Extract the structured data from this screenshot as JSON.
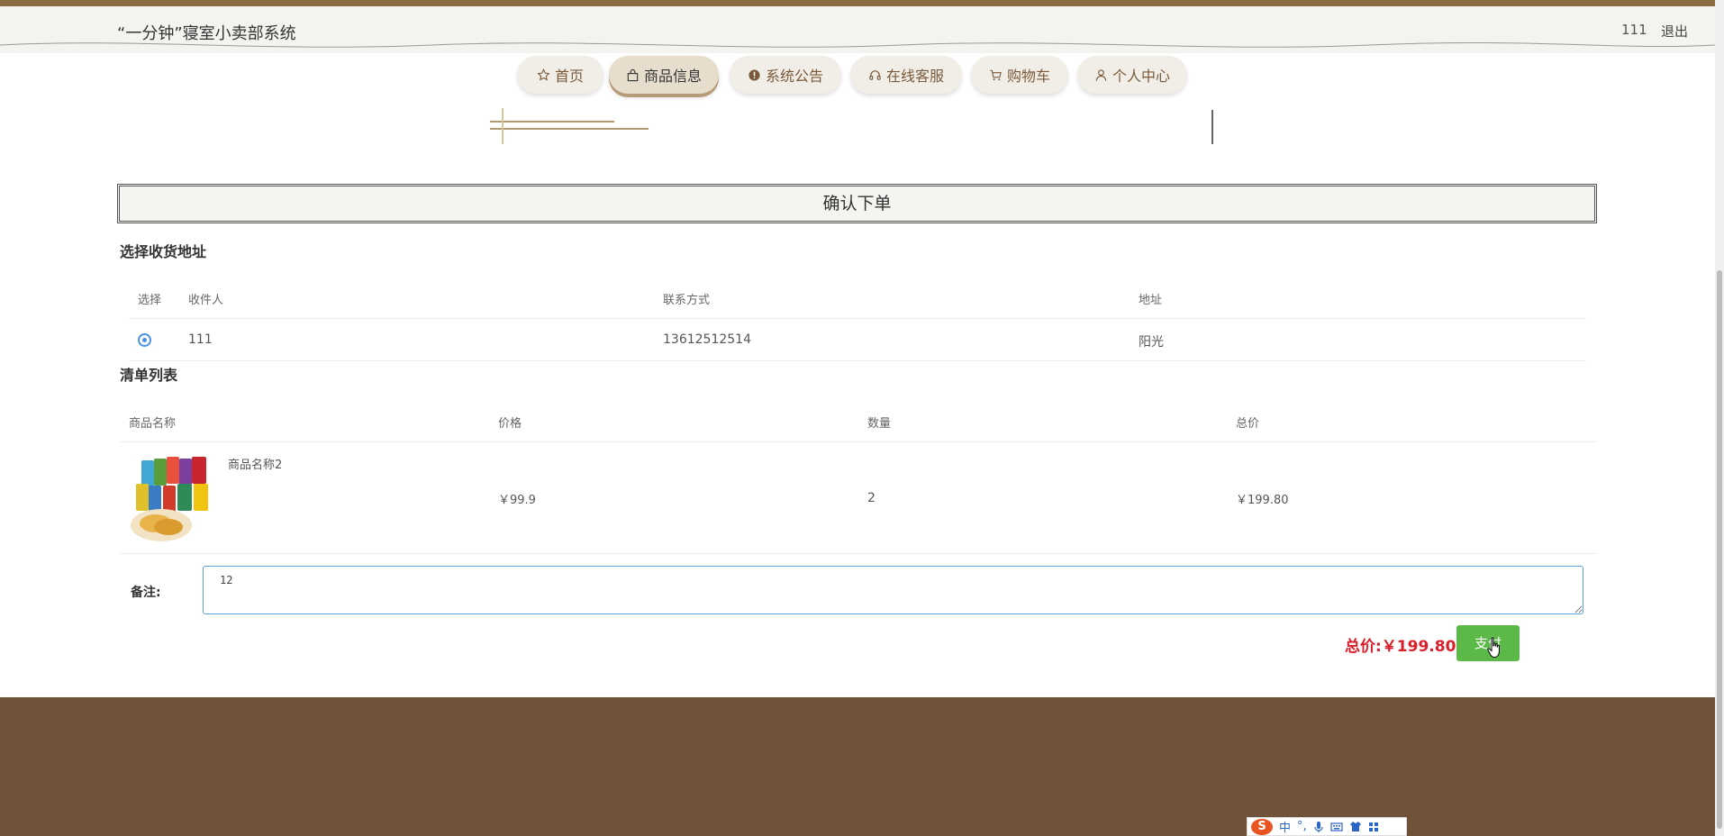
{
  "header": {
    "app_title": "“一分钟”寝室小卖部系统",
    "user_name": "111",
    "logout_label": "退出"
  },
  "nav": {
    "items": [
      {
        "label": "首页",
        "icon": "star-icon"
      },
      {
        "label": "商品信息",
        "icon": "bag-icon",
        "active": true
      },
      {
        "label": "系统公告",
        "icon": "alert-icon"
      },
      {
        "label": "在线客服",
        "icon": "headset-icon"
      },
      {
        "label": "购物车",
        "icon": "cart-icon"
      },
      {
        "label": "个人中心",
        "icon": "user-icon"
      }
    ]
  },
  "order": {
    "confirm_title": "确认下单",
    "address_section": {
      "title": "选择收货地址",
      "headers": [
        "选择",
        "收件人",
        "联系方式",
        "地址"
      ],
      "rows": [
        {
          "selected": true,
          "recipient": "111",
          "phone": "13612512514",
          "address": "阳光"
        }
      ]
    },
    "list_section": {
      "title": "清单列表",
      "headers": [
        "商品名称",
        "价格",
        "数量",
        "总价"
      ],
      "items": [
        {
          "name": "商品名称2",
          "price": "￥99.9",
          "quantity": "2",
          "total": "￥199.80",
          "image": "potato-chips-image"
        }
      ]
    },
    "note_label": "备注:",
    "note_value": "12",
    "total_label": "总价:￥199.80",
    "pay_label": "支付"
  },
  "ime": {
    "mode": "中",
    "punct": "°,"
  },
  "colors": {
    "brand_brown": "#6f5237",
    "accent_red": "#d9202a",
    "pay_green": "#5bb948",
    "radio_blue": "#4a90e2"
  }
}
